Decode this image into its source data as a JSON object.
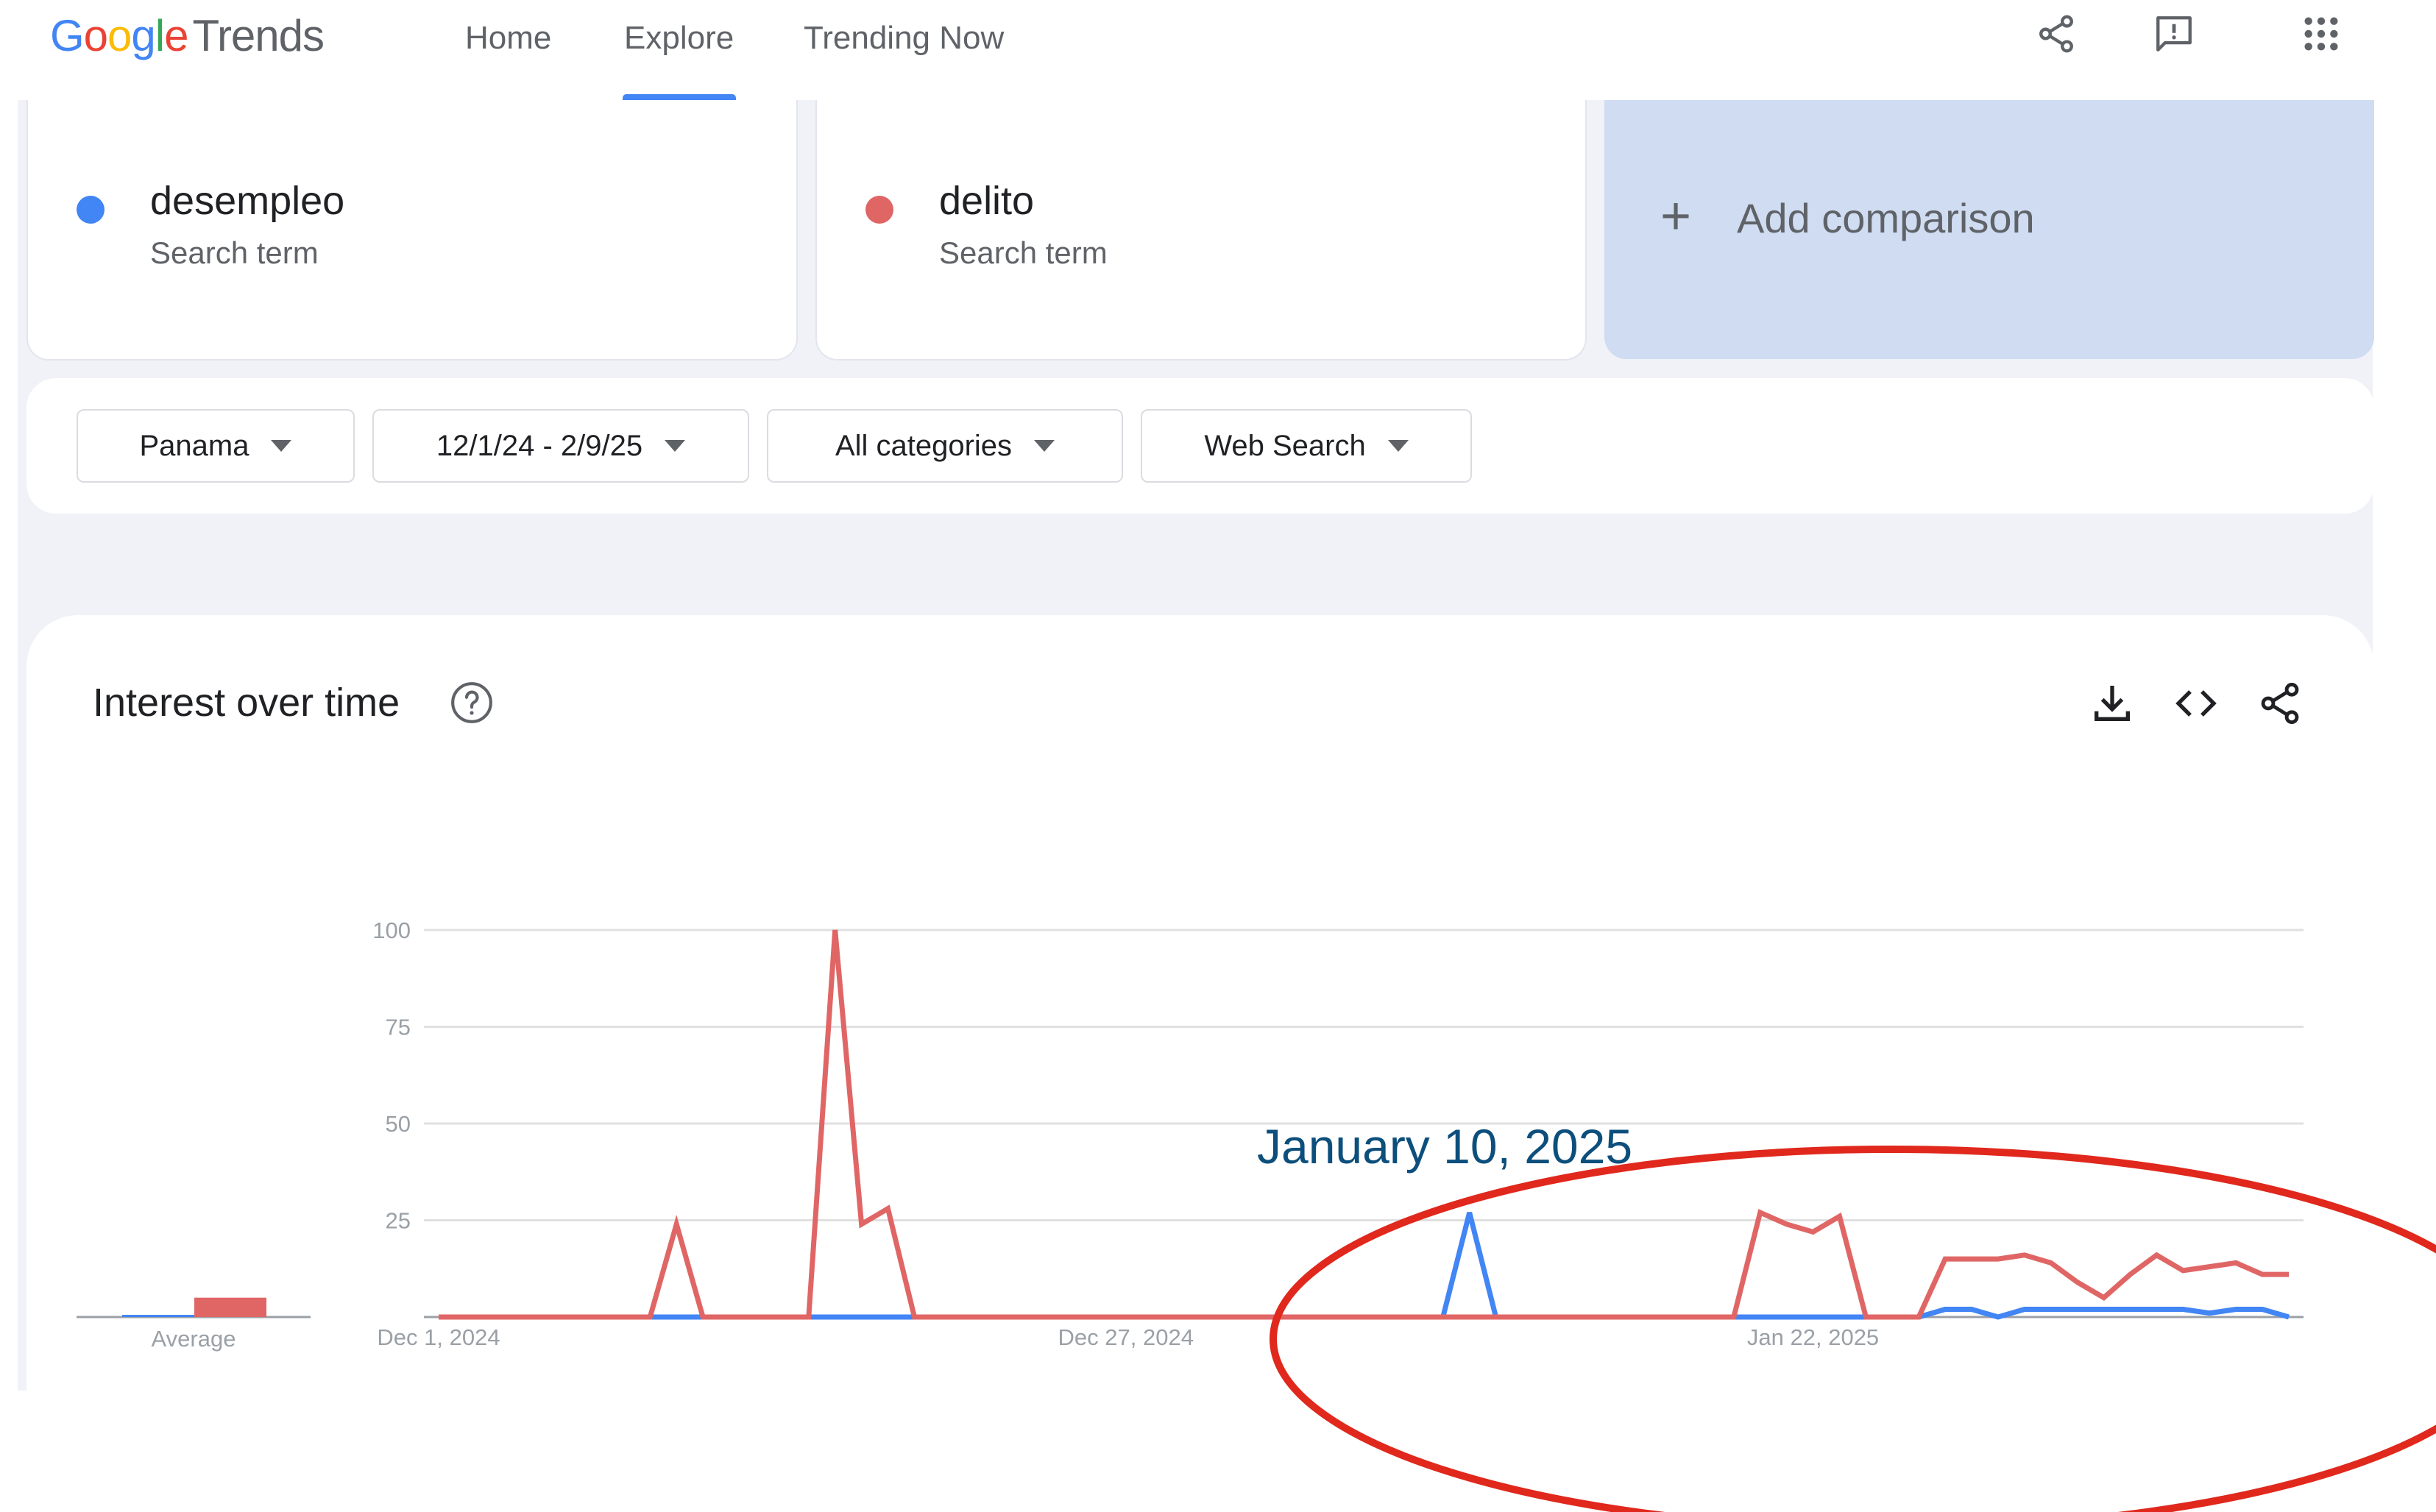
{
  "header": {
    "logo_google_letters": [
      "G",
      "o",
      "o",
      "g",
      "l",
      "e"
    ],
    "logo_trends": "Trends",
    "nav": {
      "home": "Home",
      "explore": "Explore",
      "trending": "Trending Now"
    },
    "icons": [
      "share-icon",
      "feedback-icon",
      "apps-grid-icon"
    ]
  },
  "terms": [
    {
      "name": "desempleo",
      "subtitle": "Search term",
      "color": "#4285F4"
    },
    {
      "name": "delito",
      "subtitle": "Search term",
      "color": "#E06666"
    }
  ],
  "add_comparison": {
    "plus": "+",
    "label": "Add comparison"
  },
  "filters": {
    "region": "Panama",
    "date_range": "12/1/24 - 2/9/25",
    "category": "All categories",
    "search_type": "Web Search"
  },
  "chart_section": {
    "title": "Interest over time",
    "icons": [
      "help-icon",
      "download-icon",
      "embed-icon",
      "share-icon"
    ]
  },
  "annotation": {
    "text": "January 10, 2025",
    "color": "#0d4f7c",
    "ellipse_color": "#e0281d"
  },
  "chart_data": {
    "type": "line",
    "y_ticks": [
      "100",
      "75",
      "50",
      "25"
    ],
    "ylim": [
      0,
      100
    ],
    "x_tick_labels": [
      "Dec 1, 2024",
      "Dec 27, 2024",
      "Jan 22, 2025"
    ],
    "average_label": "Average",
    "averages": [
      {
        "name": "desempleo",
        "value": 0.5
      },
      {
        "name": "delito",
        "value": 5
      }
    ],
    "series": [
      {
        "name": "desempleo",
        "color": "#4285F4",
        "points": [
          [
            "2024-12-01",
            0
          ],
          [
            "2024-12-09",
            0
          ],
          [
            "2024-12-10",
            0
          ],
          [
            "2024-12-15",
            0
          ],
          [
            "2024-12-16",
            0
          ],
          [
            "2024-12-17",
            0
          ],
          [
            "2024-12-18",
            0
          ],
          [
            "2025-01-07",
            0
          ],
          [
            "2025-01-08",
            0
          ],
          [
            "2025-01-09",
            27
          ],
          [
            "2025-01-10",
            0
          ],
          [
            "2025-01-11",
            0
          ],
          [
            "2025-01-12",
            0
          ],
          [
            "2025-01-17",
            0
          ],
          [
            "2025-01-21",
            0
          ],
          [
            "2025-01-23",
            0
          ],
          [
            "2025-01-24",
            0
          ],
          [
            "2025-01-25",
            0
          ],
          [
            "2025-01-26",
            0
          ],
          [
            "2025-01-27",
            2
          ],
          [
            "2025-01-28",
            2
          ],
          [
            "2025-01-29",
            0
          ],
          [
            "2025-01-30",
            2
          ],
          [
            "2025-01-31",
            2
          ],
          [
            "2025-02-01",
            2
          ],
          [
            "2025-02-02",
            2
          ],
          [
            "2025-02-03",
            2
          ],
          [
            "2025-02-04",
            2
          ],
          [
            "2025-02-05",
            2
          ],
          [
            "2025-02-06",
            1
          ],
          [
            "2025-02-07",
            2
          ],
          [
            "2025-02-08",
            2
          ],
          [
            "2025-02-09",
            0
          ]
        ]
      },
      {
        "name": "delito",
        "color": "#E06666",
        "points": [
          [
            "2024-12-01",
            0
          ],
          [
            "2024-12-09",
            0
          ],
          [
            "2024-12-10",
            24
          ],
          [
            "2024-12-11",
            0
          ],
          [
            "2024-12-15",
            0
          ],
          [
            "2024-12-16",
            100
          ],
          [
            "2024-12-17",
            24
          ],
          [
            "2024-12-18",
            28
          ],
          [
            "2024-12-19",
            0
          ],
          [
            "2025-01-08",
            0
          ],
          [
            "2025-01-09",
            0
          ],
          [
            "2025-01-10",
            0
          ],
          [
            "2025-01-19",
            0
          ],
          [
            "2025-01-20",
            27
          ],
          [
            "2025-01-21",
            24
          ],
          [
            "2025-01-22",
            22
          ],
          [
            "2025-01-23",
            26
          ],
          [
            "2025-01-24",
            0
          ],
          [
            "2025-01-26",
            0
          ],
          [
            "2025-01-27",
            15
          ],
          [
            "2025-01-28",
            15
          ],
          [
            "2025-01-29",
            15
          ],
          [
            "2025-01-30",
            16
          ],
          [
            "2025-01-31",
            14
          ],
          [
            "2025-02-01",
            9
          ],
          [
            "2025-02-02",
            5
          ],
          [
            "2025-02-03",
            11
          ],
          [
            "2025-02-04",
            16
          ],
          [
            "2025-02-05",
            12
          ],
          [
            "2025-02-06",
            13
          ],
          [
            "2025-02-07",
            14
          ],
          [
            "2025-02-08",
            11
          ],
          [
            "2025-02-09",
            11
          ]
        ]
      }
    ]
  }
}
